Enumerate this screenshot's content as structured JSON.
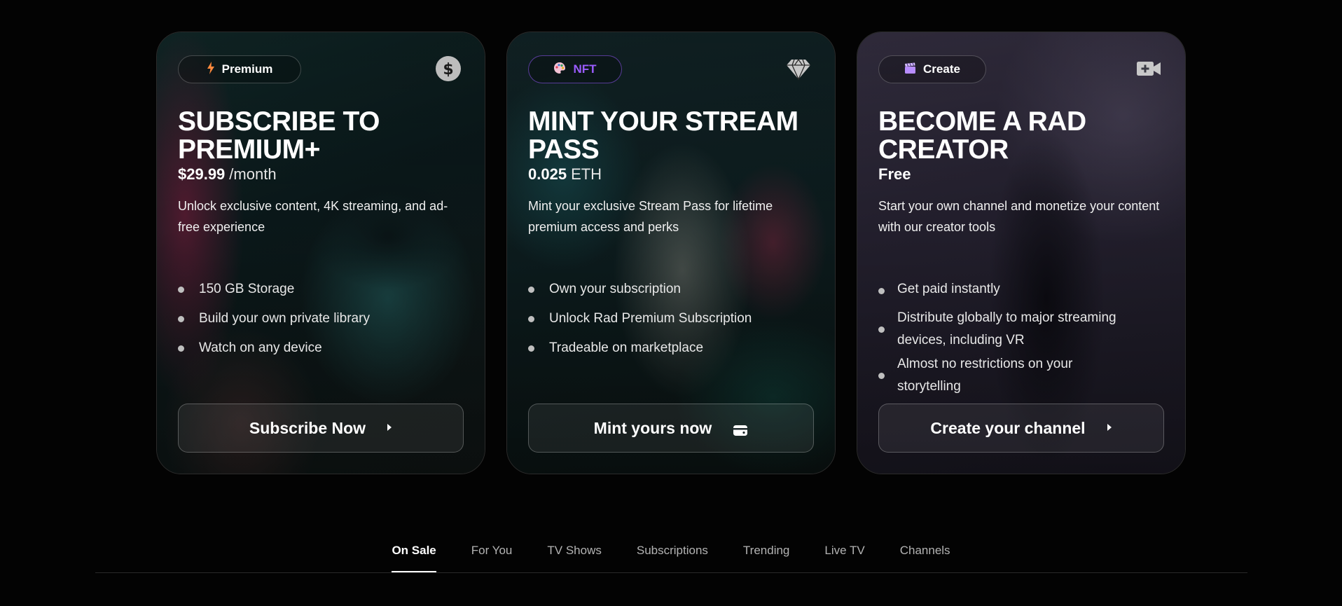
{
  "cards": [
    {
      "badge_label": "Premium",
      "badge_icon": "lightning-bolt-icon",
      "corner_icon": "dollar-circle-icon",
      "title": "SUBSCRIBE TO PREMIUM+",
      "price": "$29.99",
      "price_unit": "/month",
      "description": "Unlock exclusive content, 4K streaming, and ad-free experience",
      "features": [
        "150 GB Storage",
        "Build your own private library",
        "Watch on any device"
      ],
      "cta_label": "Subscribe Now",
      "cta_icon": "caret-right-icon"
    },
    {
      "badge_label": "NFT",
      "badge_icon": "palette-icon",
      "corner_icon": "diamond-icon",
      "title": "MINT YOUR STREAM PASS",
      "price": "0.025",
      "price_unit": "ETH",
      "description": "Mint your exclusive Stream Pass for lifetime premium access and perks",
      "features": [
        "Own your subscription",
        "Unlock Rad Premium Subscription",
        "Tradeable on marketplace"
      ],
      "cta_label": "Mint yours now",
      "cta_icon": "wallet-icon"
    },
    {
      "badge_label": "Create",
      "badge_icon": "clapperboard-icon",
      "corner_icon": "video-camera-plus-icon",
      "title": "BECOME A RAD CREATOR",
      "price": "Free",
      "price_unit": "",
      "description": "Start your own channel and monetize your content with our creator tools",
      "features": [
        "Get paid instantly",
        "Distribute globally to major streaming devices, including VR",
        "Almost no restrictions on your storytelling"
      ],
      "cta_label": "Create your channel",
      "cta_icon": "caret-right-icon"
    }
  ],
  "tabs": [
    "On Sale",
    "For You",
    "TV Shows",
    "Subscriptions",
    "Trending",
    "Live TV",
    "Channels"
  ],
  "active_tab": "On Sale",
  "colors": {
    "background": "#030303",
    "nft_accent": "#9b5cff",
    "premium_bolt": "#ff8a3d",
    "tab_inactive": "#b3b3b3"
  }
}
